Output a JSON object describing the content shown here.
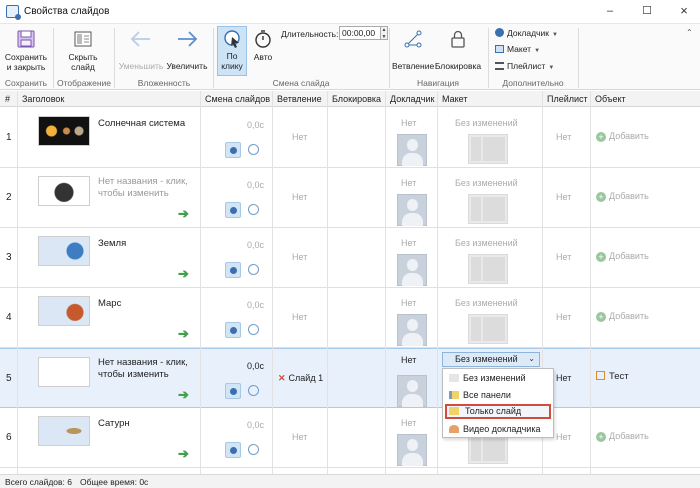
{
  "window": {
    "title": "Свойства слайдов"
  },
  "ribbon": {
    "save_close_l1": "Сохранить",
    "save_close_l2": "и закрыть",
    "group_save": "Сохранить",
    "hide_l1": "Скрыть",
    "hide_l2": "слайд",
    "group_display": "Отображение",
    "decrease": "Уменьшить",
    "increase": "Увеличить",
    "group_nesting": "Вложенность",
    "on_click_l1": "По",
    "on_click_l2": "клику",
    "auto": "Авто",
    "duration_label": "Длительность:",
    "duration_value": "00:00,00",
    "group_slide_change": "Смена слайда",
    "branching": "Ветвление",
    "lock": "Блокировка",
    "group_navigation": "Навигация",
    "narrator": "Докладчик",
    "layout": "Макет",
    "playlist": "Плейлист",
    "group_additional": "Дополнительно"
  },
  "table": {
    "headers": [
      "#",
      "Заголовок",
      "Смена слайдов",
      "Ветвление",
      "Блокировка",
      "Докладчик",
      "Макет",
      "Плейлист",
      "Объект"
    ],
    "rows": [
      {
        "num": "1",
        "title": "Солнечная система",
        "duration": "0,0с",
        "branch": "Нет",
        "narrator": "Нет",
        "layout": "Без изменений",
        "playlist": "Нет",
        "object": "Добавить"
      },
      {
        "num": "2",
        "title": "Нет названия - клик, чтобы изменить",
        "duration": "0,0с",
        "branch": "Нет",
        "narrator": "Нет",
        "layout": "Без изменений",
        "playlist": "Нет",
        "object": "Добавить"
      },
      {
        "num": "3",
        "title": "Земля",
        "duration": "0,0с",
        "branch": "Нет",
        "narrator": "Нет",
        "layout": "Без изменений",
        "playlist": "Нет",
        "object": "Добавить"
      },
      {
        "num": "4",
        "title": "Марс",
        "duration": "0,0с",
        "branch": "Нет",
        "narrator": "Нет",
        "layout": "Без изменений",
        "playlist": "Нет",
        "object": "Добавить"
      },
      {
        "num": "5",
        "title": "Нет названия - клик, чтобы изменить",
        "duration": "0,0с",
        "branch": "Слайд 1",
        "narrator": "Нет",
        "layout": "Без изменений",
        "playlist": "Нет",
        "object": "Тест"
      },
      {
        "num": "6",
        "title": "Сатурн",
        "duration": "0,0с",
        "branch": "Нет",
        "narrator": "Нет",
        "layout": "Без изменений",
        "playlist": "Нет",
        "object": "Добавить"
      }
    ]
  },
  "layout_menu": {
    "items": [
      "Без изменений",
      "Все панели",
      "Только слайд",
      "Видео докладчика"
    ],
    "highlighted": "Только слайд"
  },
  "status": {
    "total_slides": "Всего слайдов: 6",
    "total_time": "Общее время:  0с"
  },
  "colors": {
    "accent": "#3a6fb0",
    "selected_row": "#e8f1fb",
    "highlight_border": "#d24b3b",
    "green": "#3fa24a"
  }
}
